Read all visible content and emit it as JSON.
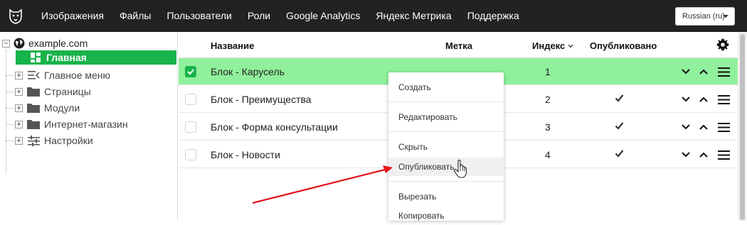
{
  "topbar": {
    "nav": [
      "Изображения",
      "Файлы",
      "Пользователи",
      "Роли",
      "Google Analytics",
      "Яндекс Метрика",
      "Поддержка"
    ],
    "language": "Russian (ru)"
  },
  "sidebar": {
    "root": "example.com",
    "active": "Главная",
    "items": [
      {
        "label": "Главное меню",
        "icon": "menu-icon"
      },
      {
        "label": "Страницы",
        "icon": "folder-icon"
      },
      {
        "label": "Модули",
        "icon": "folder-icon"
      },
      {
        "label": "Интернет-магазин",
        "icon": "folder-icon"
      },
      {
        "label": "Настройки",
        "icon": "sliders-icon"
      }
    ]
  },
  "table": {
    "headers": {
      "name": "Название",
      "tag": "Метка",
      "index": "Индекс",
      "published": "Опубликовано"
    },
    "rows": [
      {
        "name": "Блок - Карусель",
        "index": "1",
        "published": false,
        "selected": true
      },
      {
        "name": "Блок - Преимущества",
        "index": "2",
        "published": true,
        "selected": false
      },
      {
        "name": "Блок - Форма консультации",
        "index": "3",
        "published": true,
        "selected": false
      },
      {
        "name": "Блок - Новости",
        "index": "4",
        "published": true,
        "selected": false
      }
    ]
  },
  "context_menu": {
    "items": [
      "Создать",
      "Редактировать",
      "Скрыть",
      "Опубликовать",
      "Вырезать",
      "Копировать"
    ],
    "hovered": "Опубликовать"
  },
  "colors": {
    "topbar": "#222222",
    "accent_green": "#19b34b",
    "selected_row": "#90f09c",
    "arrow": "#e8141b"
  }
}
